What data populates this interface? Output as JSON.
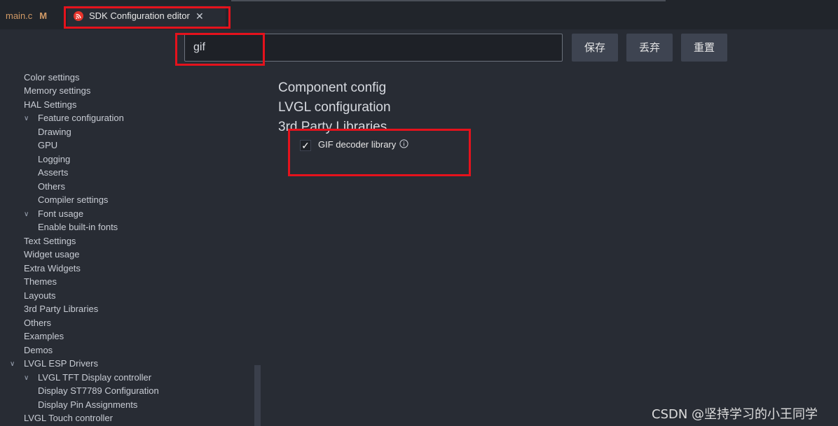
{
  "tabs": [
    {
      "label": "main.c",
      "badge": "M"
    },
    {
      "label": "SDK Configuration editor",
      "close_icon": "close-icon",
      "logo_icon": "espressif-logo-icon"
    }
  ],
  "search": {
    "value": "gif",
    "placeholder": ""
  },
  "buttons": {
    "save": "保存",
    "discard": "丢弃",
    "reset": "重置"
  },
  "sidebar": {
    "items": [
      {
        "label": "Color settings"
      },
      {
        "label": "Memory settings"
      },
      {
        "label": "HAL Settings"
      },
      {
        "label": "Feature configuration",
        "expanded": true
      },
      {
        "label": "Drawing"
      },
      {
        "label": "GPU"
      },
      {
        "label": "Logging"
      },
      {
        "label": "Asserts"
      },
      {
        "label": "Others"
      },
      {
        "label": "Compiler settings"
      },
      {
        "label": "Font usage",
        "expanded": true
      },
      {
        "label": "Enable built-in fonts"
      },
      {
        "label": "Text Settings"
      },
      {
        "label": "Widget usage"
      },
      {
        "label": "Extra Widgets"
      },
      {
        "label": "Themes"
      },
      {
        "label": "Layouts"
      },
      {
        "label": "3rd Party Libraries"
      },
      {
        "label": "Others"
      },
      {
        "label": "Examples"
      },
      {
        "label": "Demos"
      },
      {
        "label": "LVGL ESP Drivers",
        "expanded": true
      },
      {
        "label": "LVGL TFT Display controller",
        "expanded": true
      },
      {
        "label": "Display ST7789 Configuration"
      },
      {
        "label": "Display Pin Assignments"
      },
      {
        "label": "LVGL Touch controller"
      }
    ]
  },
  "main": {
    "sections": [
      "Component config",
      "LVGL configuration",
      "3rd Party Libraries"
    ],
    "option": {
      "label": "GIF decoder library",
      "checked": true,
      "info_icon": "info-icon"
    }
  },
  "watermark": "CSDN @坚持学习的小王同学",
  "colors": {
    "accent_red": "#e5121c",
    "background": "#282c34",
    "tabbar": "#21252b"
  }
}
